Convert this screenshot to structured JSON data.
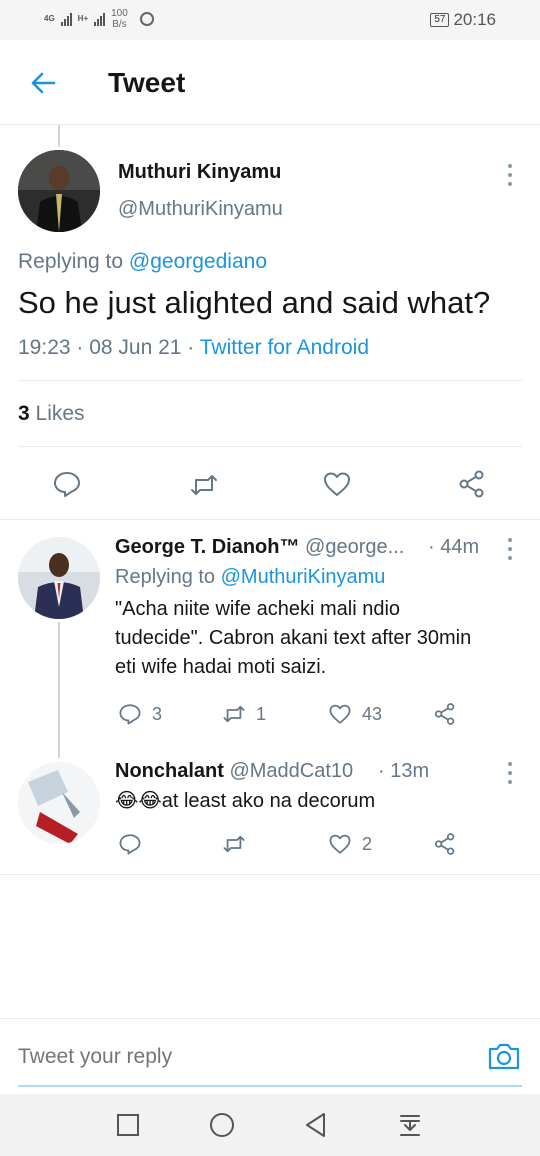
{
  "status_bar": {
    "signal1": "4G",
    "signal2": "H+",
    "speed_value": "100",
    "speed_unit": "B/s",
    "battery": "57",
    "time": "20:16"
  },
  "header": {
    "title": "Tweet"
  },
  "main_tweet": {
    "author_name": "Muthuri Kinyamu",
    "author_handle": "@MuthuriKinyamu",
    "replying_label": "Replying to",
    "replying_to": "@georgediano",
    "text": "So he just alighted and said what?",
    "time_date": "19:23 · 08 Jun 21 ·",
    "source": "Twitter for Android",
    "likes_count": "3",
    "likes_label": "Likes"
  },
  "replies": [
    {
      "name": "George T. Dianoh™",
      "handle": "@george...",
      "time": "· 44m",
      "replying_label": "Replying to",
      "replying_to": "@MuthuriKinyamu",
      "text_line1": "\"Acha niite wife acheki mali ndio",
      "text_line2": "tudecide\". Cabron akani text after 30min",
      "text_line3": "eti wife hadai moti saizi.",
      "reply_count": "3",
      "retweet_count": "1",
      "like_count": "43"
    },
    {
      "name": "Nonchalant",
      "handle": "@MaddCat10",
      "time": "· 13m",
      "emoji": "😂😂",
      "text": "at least ako na decorum",
      "reply_count": "",
      "retweet_count": "",
      "like_count": "2"
    }
  ],
  "reply_box": {
    "placeholder": "Tweet your reply"
  },
  "colors": {
    "accent": "#1b95e0",
    "secondary_text": "#657786",
    "divider": "#e6ecf0"
  },
  "icons": [
    "back-arrow-icon",
    "more-vertical-icon",
    "reply-icon",
    "retweet-icon",
    "like-icon",
    "share-icon",
    "camera-icon",
    "nav-square-icon",
    "nav-circle-icon",
    "nav-back-triangle-icon",
    "nav-notification-icon"
  ]
}
